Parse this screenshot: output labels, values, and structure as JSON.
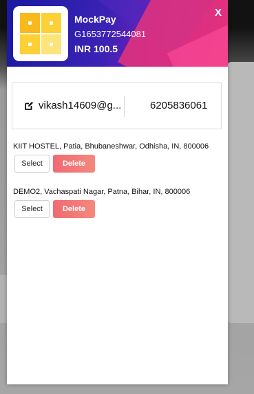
{
  "header": {
    "merchant_name": "MockPay",
    "order_id": "G1653772544081",
    "amount": "INR 100.5",
    "close_label": "X",
    "colors": {
      "gradient_start": "#1a1aa0",
      "gradient_end": "#c8218a",
      "accent_pink": "#e8337a"
    }
  },
  "user": {
    "email": "vikash14609@g...",
    "phone": "6205836061",
    "edit_icon": "edit-icon"
  },
  "addresses": [
    {
      "text": "KIIT HOSTEL, Patia, Bhubaneshwar, Odhisha, IN, 800006",
      "select_label": "Select",
      "delete_label": "Delete"
    },
    {
      "text": "DEMO2, Vachaspati Nagar, Patna, Bihar, IN, 800006",
      "select_label": "Select",
      "delete_label": "Delete"
    }
  ],
  "colors": {
    "delete_button": "#f06a73"
  }
}
